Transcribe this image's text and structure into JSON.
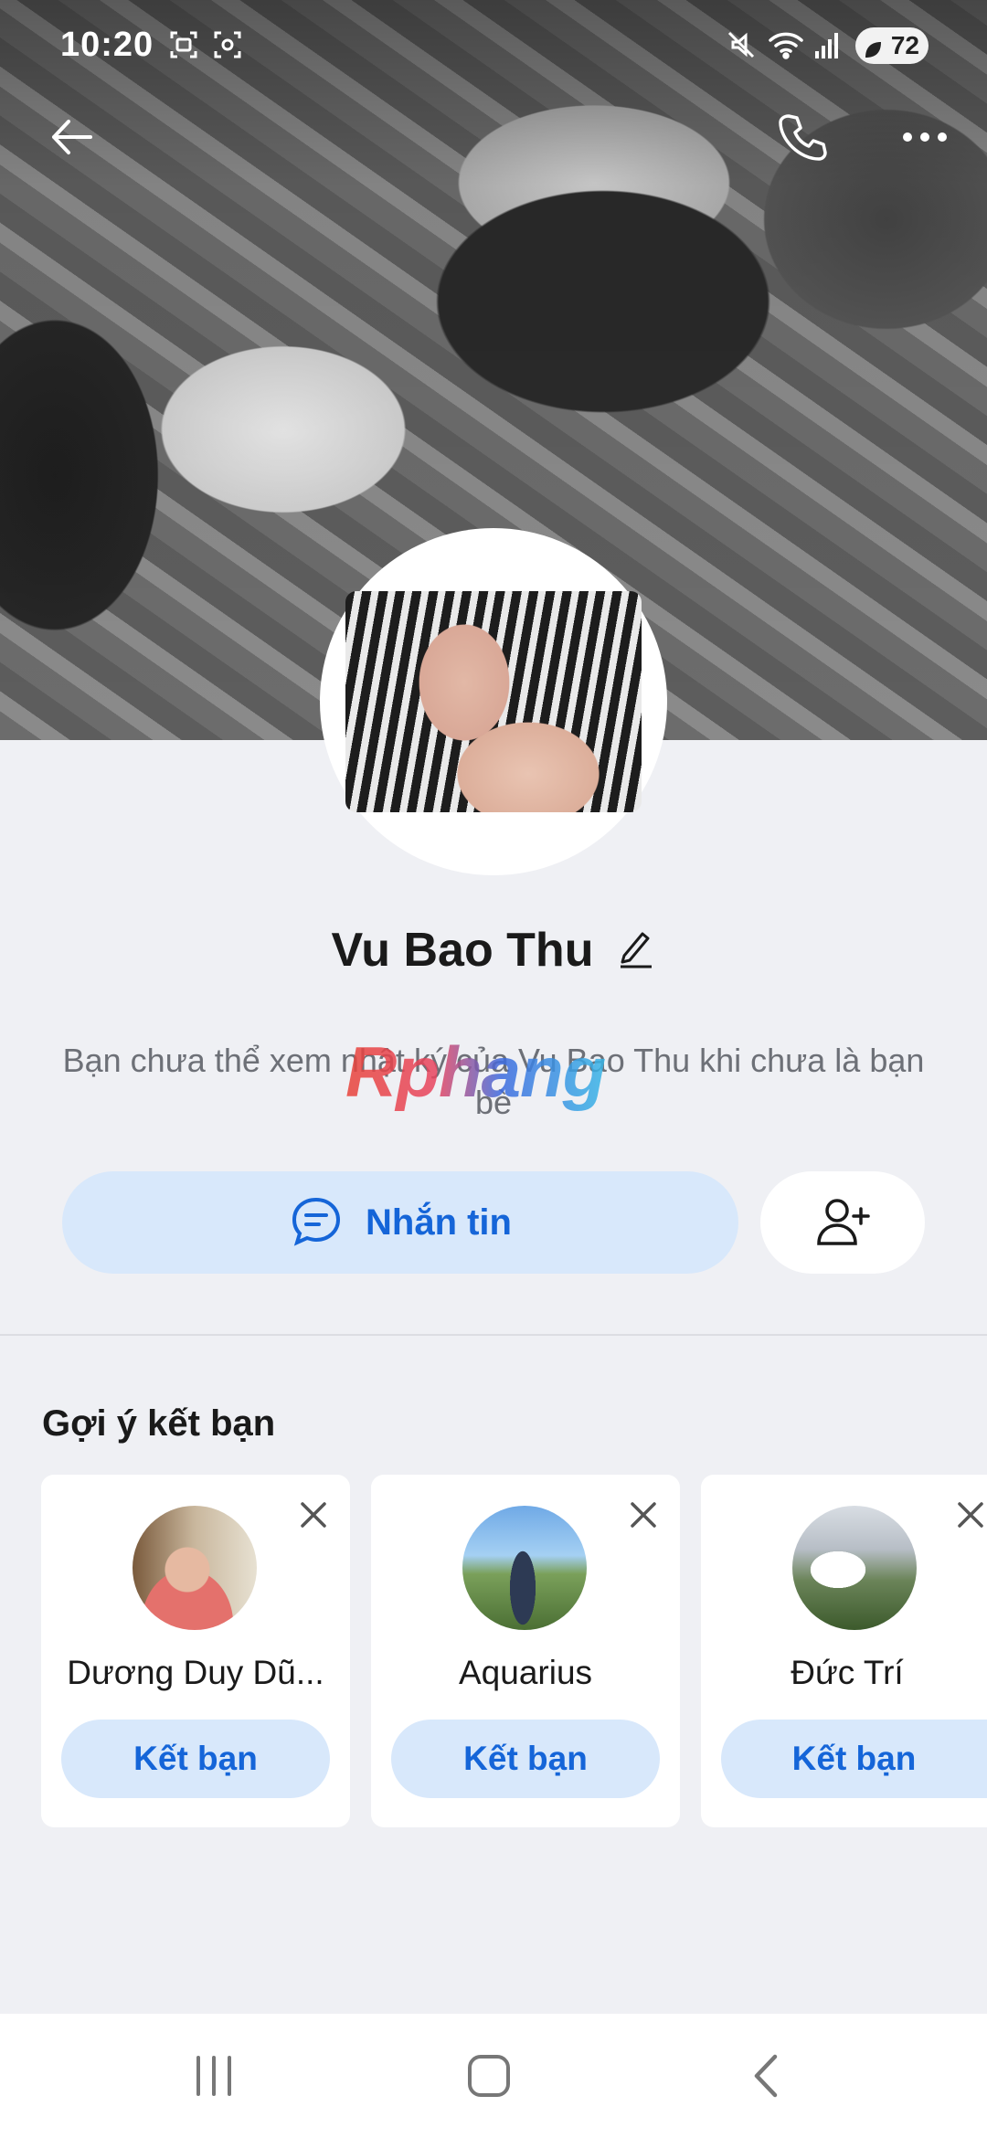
{
  "status_bar": {
    "time": "10:20",
    "battery": "72"
  },
  "top_bar": {
    "back_icon": "arrow-left-icon",
    "call_icon": "phone-icon",
    "more_icon": "more-dots-icon"
  },
  "profile": {
    "name": "Vu Bao Thu",
    "notice": "Bạn chưa thể xem nhật ký của Vu Bao Thu khi chưa là bạn bè",
    "watermark": "Rphang"
  },
  "actions": {
    "message_label": "Nhắn tin",
    "add_friend_icon": "add-user-icon"
  },
  "suggestions": {
    "title": "Gợi ý kết bạn",
    "items": [
      {
        "name": "Dương Duy Dũ...",
        "button": "Kết bạn"
      },
      {
        "name": "Aquarius",
        "button": "Kết bạn"
      },
      {
        "name": "Đức Trí",
        "button": "Kết bạn"
      }
    ]
  },
  "colors": {
    "accent": "#1565d8",
    "accent_bg": "#d8e8fb",
    "page_bg": "#eff0f4"
  }
}
